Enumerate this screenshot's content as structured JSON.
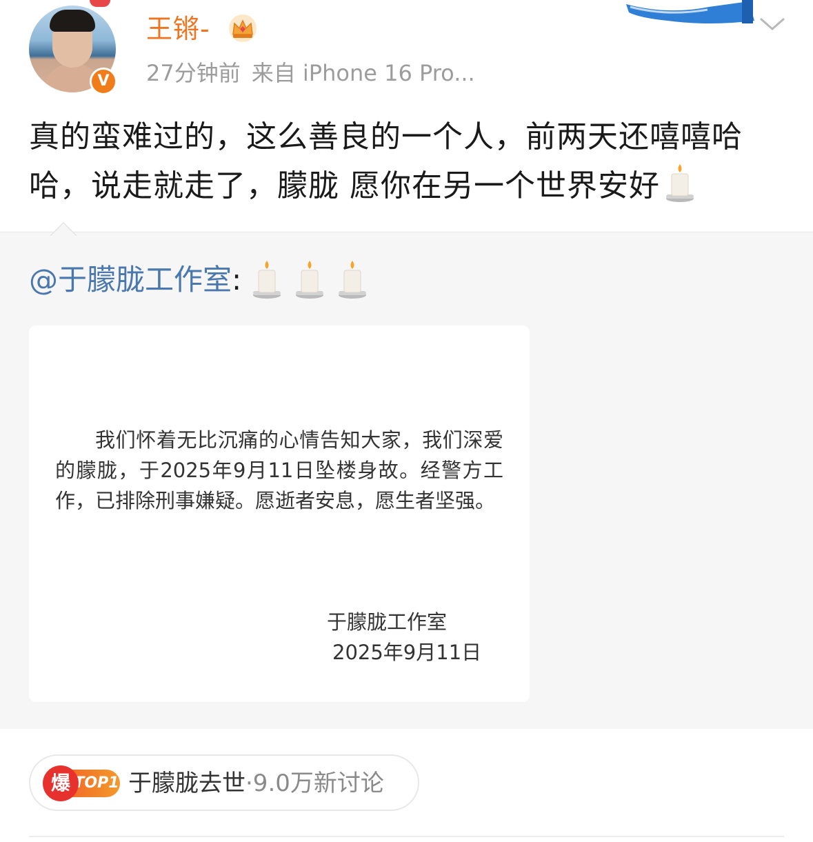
{
  "post": {
    "username": "王锵-",
    "time": "27分钟前",
    "source": "来自 iPhone 16 Pro...",
    "text": "真的蛮难过的，这么善良的一个人，前两天还嘻嘻哈哈，说走就走了，朦胧 愿你在另一个世界安好",
    "icons": [
      "avatar",
      "verified-v-badge",
      "vip-crown-icon",
      "ribbon-decoration",
      "chevron-down-icon",
      "candle-emoji"
    ]
  },
  "repost": {
    "user": "@于朦胧工作室",
    "separator": ":",
    "candles": 3,
    "notice": {
      "body": "我们怀着无比沉痛的心情告知大家，我们深爱的朦胧，于2025年9月11日坠楼身故。经警方工作，已排除刑事嫌疑。愿逝者安息，愿生者坚强。",
      "signature": "于朦胧工作室",
      "date": "2025年9月11日"
    }
  },
  "hot_topic": {
    "badge_char": "爆",
    "rank_label": "TOP1",
    "title": "于朦胧去世",
    "count": "·9.0万新讨论"
  },
  "colors": {
    "username": "#ef7420",
    "link": "#4a78ae",
    "meta": "#9c9c9c",
    "repost_bg": "#f6f6f6",
    "hot_red": "#e6312d",
    "hot_orange": "#f26a27"
  }
}
